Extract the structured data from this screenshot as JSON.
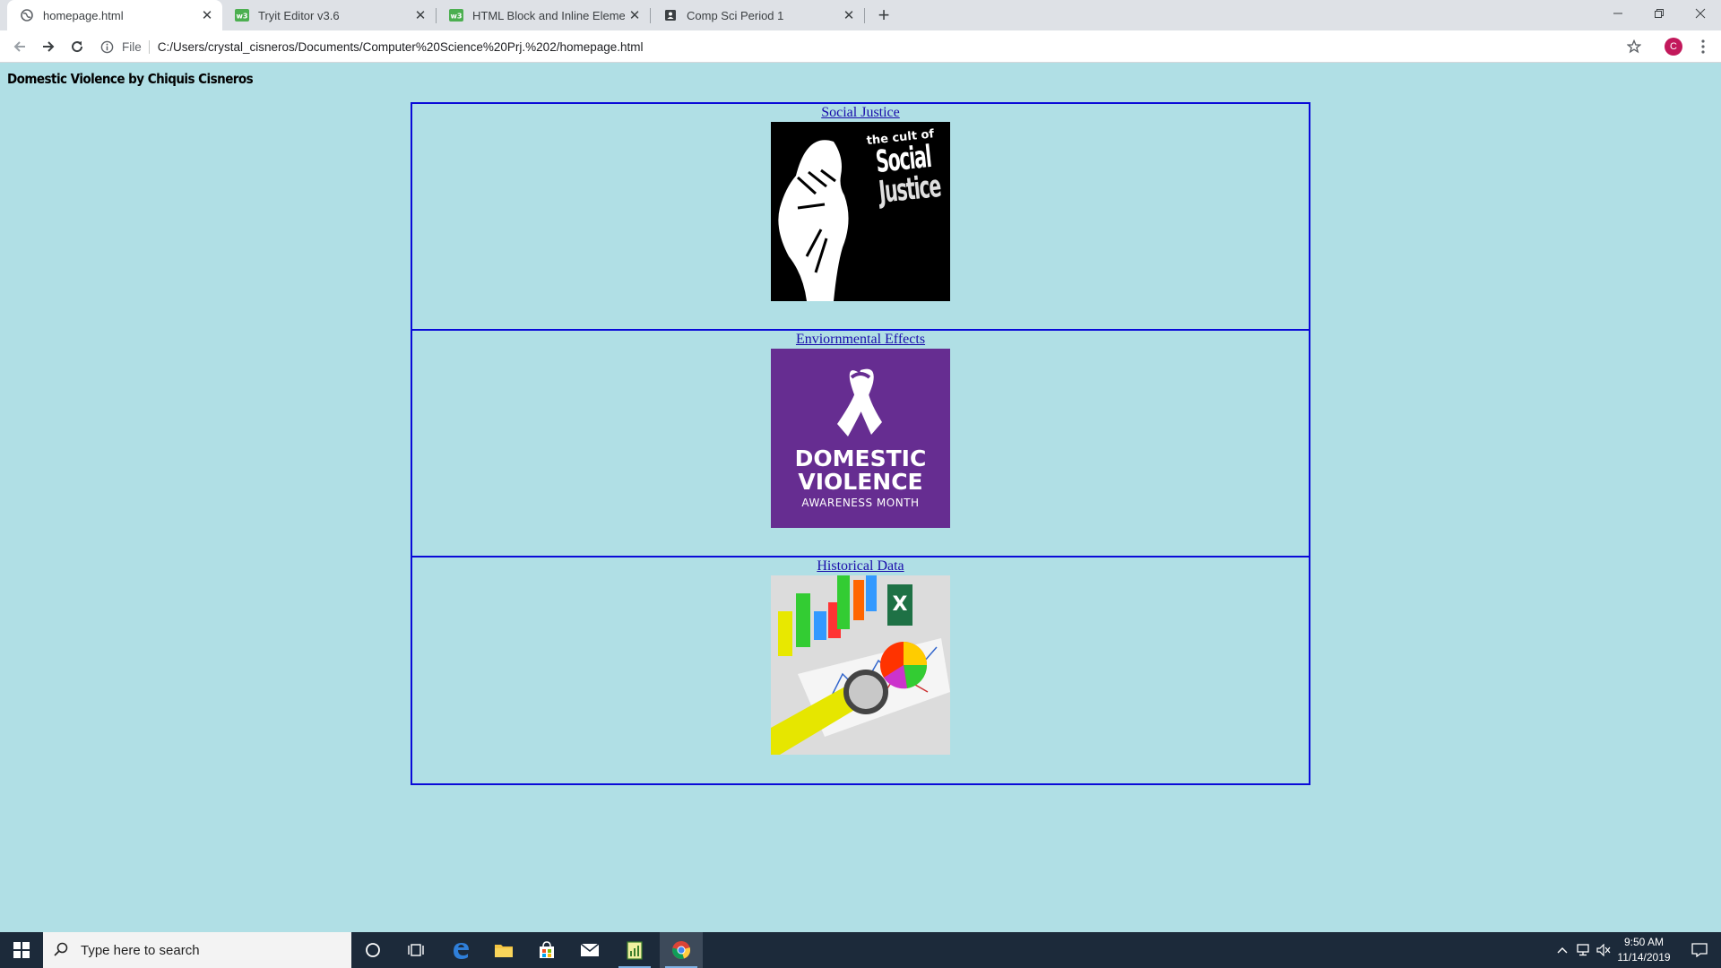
{
  "browser": {
    "tabs": [
      {
        "title": "homepage.html",
        "active": true,
        "icon": "globe-icon"
      },
      {
        "title": "Tryit Editor v3.6",
        "active": false,
        "icon": "w3schools-icon"
      },
      {
        "title": "HTML Block and Inline Elements",
        "active": false,
        "icon": "w3schools-icon"
      },
      {
        "title": "Comp Sci Period 1",
        "active": false,
        "icon": "classroom-icon"
      }
    ],
    "address": {
      "scheme_label": "File",
      "url": "C:/Users/crystal_cisneros/Documents/Computer%20Science%20Prj.%202/homepage.html"
    },
    "profile_initial": "C"
  },
  "page": {
    "title": "Domestic Violence by Chiquis Cisneros",
    "sections": [
      {
        "link": "Social Justice",
        "image": "fist-social-justice-image"
      },
      {
        "link": "Enviornmental Effects",
        "image": "domestic-violence-awareness-image"
      },
      {
        "link": "Historical Data",
        "image": "charts-data-image"
      }
    ],
    "images": {
      "social_justice": {
        "line1": "the cult of",
        "line2": "Social",
        "line3": "Justice"
      },
      "awareness": {
        "line1": "DOMESTIC",
        "line2": "VIOLENCE",
        "line3": "AWARENESS MONTH"
      },
      "data_excel_letter": "X"
    }
  },
  "taskbar": {
    "search_placeholder": "Type here to search",
    "time": "9:50 AM",
    "date": "11/14/2019"
  },
  "colors": {
    "page_bg": "#b0dfe5",
    "section_border": "#0a0ad8",
    "link": "#1a0dab",
    "awareness_purple": "#662d91",
    "taskbar": "#1c2a3a"
  }
}
